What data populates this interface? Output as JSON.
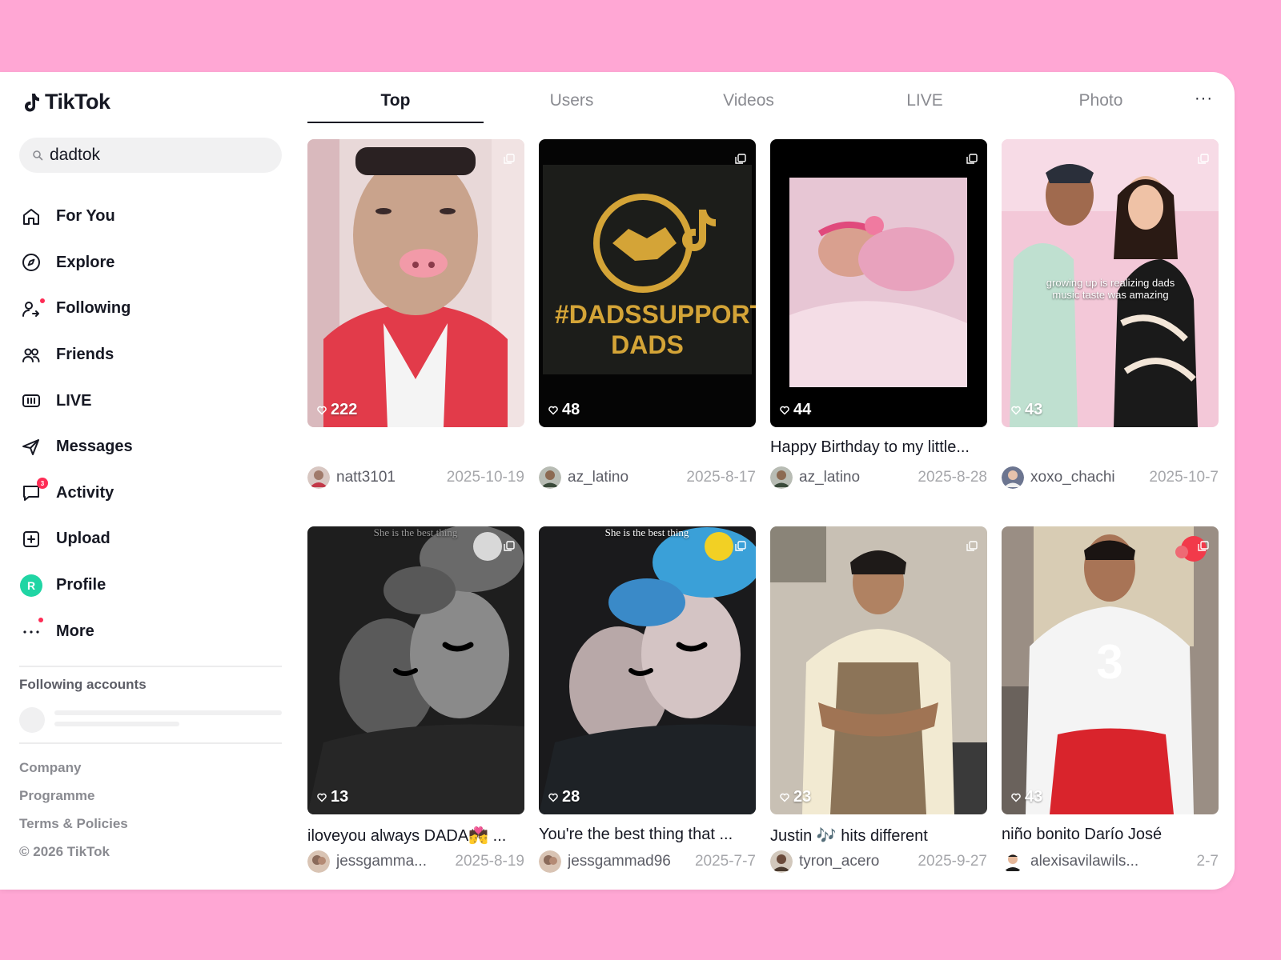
{
  "app": {
    "name": "TikTok"
  },
  "search": {
    "value": "dadtok"
  },
  "nav": [
    {
      "label": "For You",
      "icon": "home-icon"
    },
    {
      "label": "Explore",
      "icon": "compass-icon"
    },
    {
      "label": "Following",
      "icon": "following-icon",
      "dot": true
    },
    {
      "label": "Friends",
      "icon": "friends-icon"
    },
    {
      "label": "LIVE",
      "icon": "live-icon"
    },
    {
      "label": "Messages",
      "icon": "send-icon"
    },
    {
      "label": "Activity",
      "icon": "activity-icon",
      "badge": "3"
    },
    {
      "label": "Upload",
      "icon": "upload-icon"
    },
    {
      "label": "Profile",
      "icon": "profile-avatar",
      "avatar_letter": "R"
    },
    {
      "label": "More",
      "icon": "more-icon",
      "dot": true
    }
  ],
  "following": {
    "title": "Following accounts"
  },
  "footer": [
    "Company",
    "Programme",
    "Terms & Policies",
    "© 2026 TikTok"
  ],
  "tabs": [
    "Top",
    "Users",
    "Videos",
    "LIVE",
    "Photo"
  ],
  "tab_more": "···",
  "videos": [
    {
      "likes": "222",
      "caption": "",
      "user": "natt3101",
      "date": "2025-10-19",
      "overlay": ""
    },
    {
      "likes": "48",
      "caption": "",
      "user": "az_latino",
      "date": "2025-8-17",
      "overlay": "#DADSSUPPORTING DADS"
    },
    {
      "likes": "44",
      "caption": "Happy Birthday to my little...",
      "user": "az_latino",
      "date": "2025-8-28",
      "overlay": ""
    },
    {
      "likes": "43",
      "caption": "",
      "user": "xoxo_chachi",
      "date": "2025-10-7",
      "overlay": "growing up is realizing dads music taste was amazing"
    },
    {
      "likes": "13",
      "caption": "iloveyou always DADA💏 ...",
      "user": "jessgamma...",
      "date": "2025-8-19",
      "overlay": "She is the best thing"
    },
    {
      "likes": "28",
      "caption": "You're the best thing that ...",
      "user": "jessgammad96",
      "date": "2025-7-7",
      "overlay": "She is the best thing"
    },
    {
      "likes": "23",
      "caption": "Justin 🎶  hits different",
      "user": "tyron_acero",
      "date": "2025-9-27",
      "overlay": ""
    },
    {
      "likes": "43",
      "caption": "niño bonito Darío José",
      "user": "alexisavilawils...",
      "date": "2-7",
      "overlay": "3"
    }
  ],
  "colors": {
    "accent": "#fe2c55",
    "background": "#ffa7d4",
    "profile": "#20d5a4"
  }
}
